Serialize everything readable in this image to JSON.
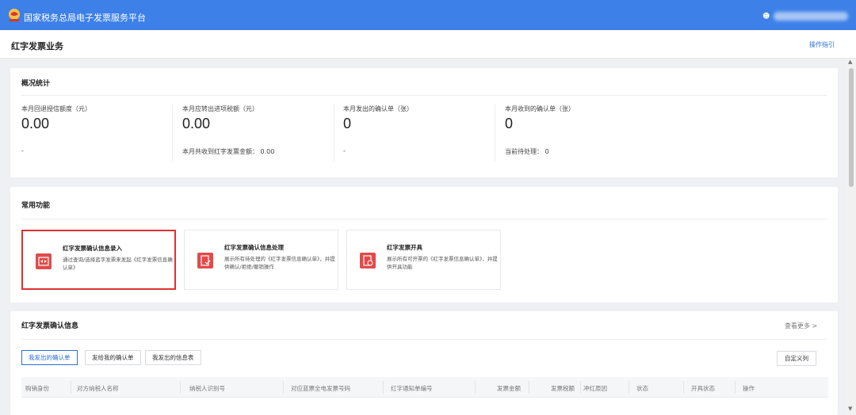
{
  "header": {
    "site_title": "国家税务总局电子发票服务平台",
    "user_icon": "user-icon"
  },
  "page": {
    "title": "红字发票业务",
    "guide_link": "操作指引"
  },
  "overview": {
    "title": "概况统计",
    "stats": [
      {
        "label": "本月回退授信额度（元）",
        "value": "0.00",
        "sub": "-"
      },
      {
        "label": "本月应转出进项税额（元）",
        "value": "0.00",
        "sub": "本月共收到红字发票金额： 0.00"
      },
      {
        "label": "本月发出的确认单（张）",
        "value": "0",
        "sub": "-"
      },
      {
        "label": "本月收到的确认单（张）",
        "value": "0",
        "sub": "当前待处理： 0"
      }
    ]
  },
  "functions": {
    "title": "常用功能",
    "items": [
      {
        "title": "红字发票确认信息录入",
        "desc": "通过查询/选择蓝字发票来发起《红字发票信息确认单》",
        "icon": "swap-icon"
      },
      {
        "title": "红字发票确认信息处理",
        "desc": "展示所有待处理的《红字发票信息确认单》，并提供确认/拒绝/撤销操作",
        "icon": "document-check-icon"
      },
      {
        "title": "红字发票开具",
        "desc": "展示所有可开票的《红字发票信息确认单》，并提供开具功能",
        "icon": "document-clock-icon"
      }
    ]
  },
  "confirm_info": {
    "title": "红字发票确认信息",
    "more_link": "查看更多 >",
    "tabs": [
      "我发出的确认单",
      "发给我的确认单",
      "我发出的信息表"
    ],
    "custom_columns_label": "自定义列",
    "columns": [
      "购销身份",
      "对方纳税人名称",
      "纳税人识别号",
      "对应蓝票全电发票号码",
      "红字通知单编号",
      "发票金额",
      "发票税额",
      "冲红原因",
      "状态",
      "开具状态",
      "操作"
    ]
  },
  "colors": {
    "header_bg": "#3d80e8",
    "accent_blue": "#2d6fd8",
    "icon_red": "#e24a4a",
    "highlight_red": "#e03131"
  }
}
